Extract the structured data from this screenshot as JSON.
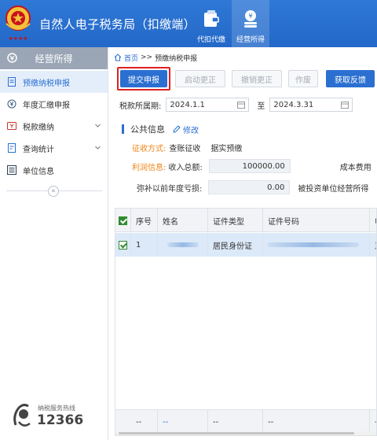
{
  "header": {
    "title": "自然人电子税务局（扣缴端）",
    "nav": [
      {
        "label": "代扣代缴",
        "icon": "wallet-icon"
      },
      {
        "label": "经营所得",
        "icon": "coins-icon",
        "active": true
      }
    ]
  },
  "sidebar": {
    "title": "经营所得",
    "items": [
      {
        "label": "预缴纳税申报",
        "icon": "document-tax-icon",
        "active": true
      },
      {
        "label": "年度汇缴申报",
        "icon": "yen-circle-icon"
      },
      {
        "label": "税款缴纳",
        "icon": "payment-icon",
        "expandable": true
      },
      {
        "label": "查询统计",
        "icon": "report-query-icon",
        "expandable": true
      },
      {
        "label": "单位信息",
        "icon": "list-icon"
      }
    ],
    "collapse_glyph": "«",
    "hotline": {
      "label": "纳税服务热线",
      "number": "12366"
    }
  },
  "breadcrumb": {
    "home": "首页",
    "separator": ">>",
    "current": "预缴纳税申报"
  },
  "toolbar": {
    "submit": "提交申报",
    "start_correction": "启动更正",
    "cancel_correction": "撤销更正",
    "void": "作废",
    "get_feedback": "获取反馈"
  },
  "period": {
    "label": "税款所属期:",
    "start": "2024.1.1",
    "to": "至",
    "end": "2024.3.31"
  },
  "public_info": {
    "title": "公共信息",
    "edit": "修改",
    "collection_label": "征收方式:",
    "collection_value": "查账征收",
    "collection_extra": "据实预缴",
    "profit_label": "利润信息:",
    "income_label": "收入总额:",
    "income_value": "100000.00",
    "cost_label": "成本费用",
    "loss_label": "弥补以前年度亏损:",
    "loss_value": "0.00",
    "invested_label": "被投资单位经营所得"
  },
  "table": {
    "columns": [
      "序号",
      "姓名",
      "证件类型",
      "证件号码",
      "申"
    ],
    "rows": [
      {
        "seq": "1",
        "name": "",
        "id_type": "居民身份证",
        "id_number": "",
        "extra": "正"
      }
    ],
    "footer": [
      "--",
      "--",
      "--",
      "--",
      "--"
    ]
  },
  "colors": {
    "header_blue": "#2b6fd0",
    "accent_orange": "#f08418",
    "highlight_red": "#e02020"
  }
}
